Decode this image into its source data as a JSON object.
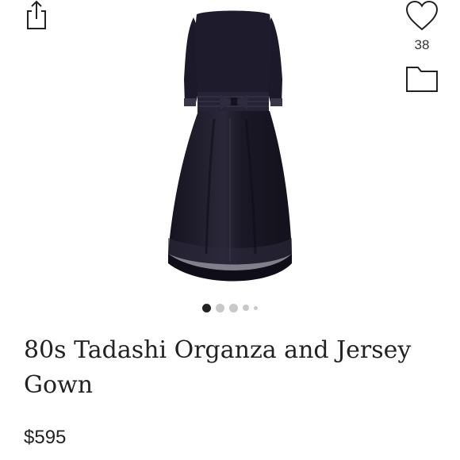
{
  "actions": {
    "like_count": "38"
  },
  "carousel": {
    "total_images": 5,
    "active_index": 0
  },
  "product": {
    "title": "80s Tadashi Organza and Jersey Gown",
    "price": "$595"
  },
  "icons": {
    "share": "share-icon",
    "like": "heart-icon",
    "bundle": "folder-icon"
  },
  "colors": {
    "text": "#222222",
    "dot_active": "#222222",
    "dot_inactive": "#c8c8c8",
    "dress": "#1c1a2a"
  }
}
